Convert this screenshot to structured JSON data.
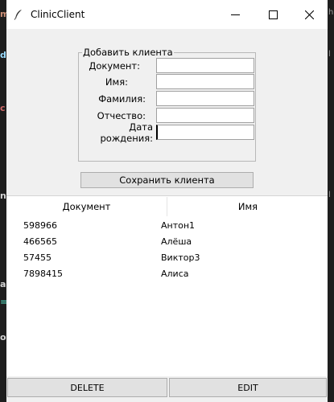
{
  "window": {
    "title": "ClinicClient",
    "controls": {
      "minimize": "minimize-icon",
      "maximize": "maximize-icon",
      "close": "close-icon"
    }
  },
  "form": {
    "group_label": "Добавить клиента",
    "fields": [
      {
        "label": "Документ:",
        "value": ""
      },
      {
        "label": "Имя:",
        "value": ""
      },
      {
        "label": "Фамилия:",
        "value": ""
      },
      {
        "label": "Отчество:",
        "value": ""
      },
      {
        "label": "Дата рождения:",
        "value": ""
      }
    ],
    "save_label": "Сохранить клиента"
  },
  "table": {
    "columns": [
      "Документ",
      "Имя"
    ],
    "rows": [
      [
        "598966",
        "Антон1"
      ],
      [
        "466565",
        "Алёша"
      ],
      [
        "57455",
        "Виктор3"
      ],
      [
        "7898415",
        "Алиса"
      ]
    ]
  },
  "actions": {
    "delete_label": "DELETE",
    "edit_label": "EDIT"
  },
  "colors": {
    "window_bg": "#f0f0f0",
    "titlebar_bg": "#ffffff",
    "button_bg": "#e1e1e1",
    "desktop_bg": "#1e1e1e"
  }
}
